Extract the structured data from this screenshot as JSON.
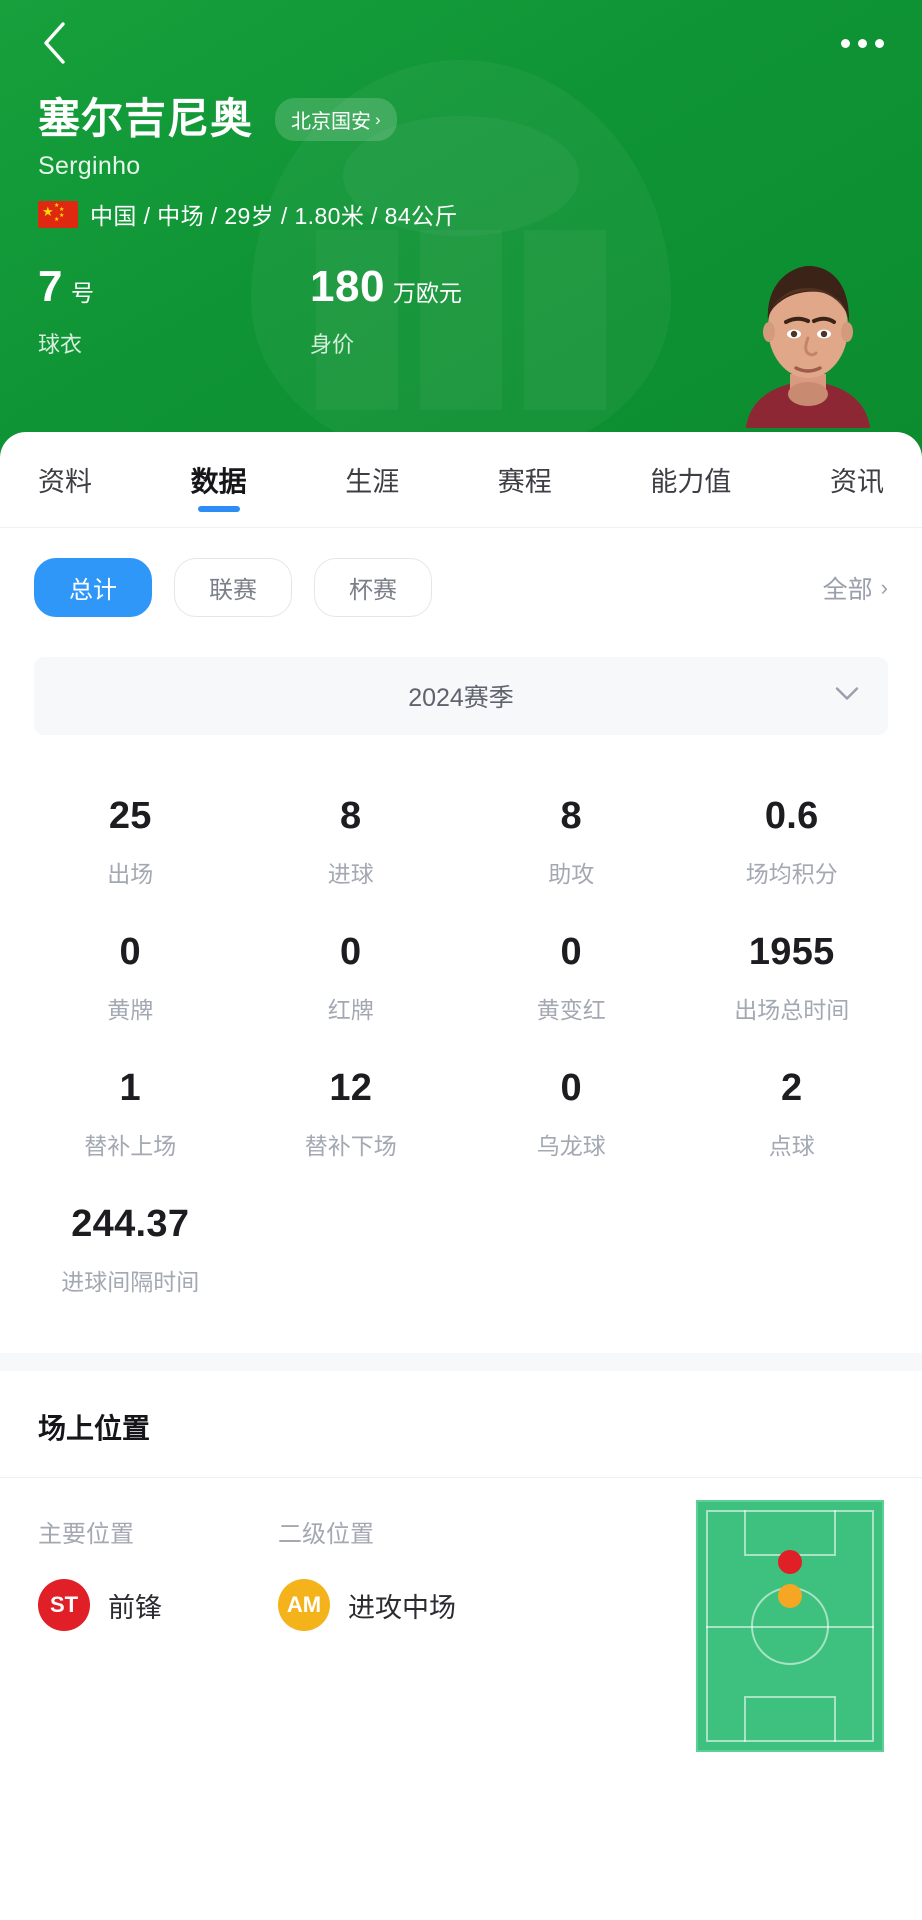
{
  "header": {
    "back_icon": "chevron-left-icon",
    "more_icon": "more-horizontal-icon",
    "player_name": "塞尔吉尼奥",
    "team_chip": "北京国安",
    "team_chip_caret": "›",
    "player_alias": "Serginho",
    "flag_icon": "china-flag-icon",
    "meta_line": "中国 / 中场 / 29岁 / 1.80米 / 84公斤",
    "brand_green": "#0f9435",
    "kv": [
      {
        "num": "7",
        "unit": "号",
        "label": "球衣"
      },
      {
        "num": "180",
        "unit": "万欧元",
        "label": "身价"
      }
    ]
  },
  "tabs": [
    {
      "label": "资料",
      "active": false
    },
    {
      "label": "数据",
      "active": true
    },
    {
      "label": "生涯",
      "active": false
    },
    {
      "label": "赛程",
      "active": false
    },
    {
      "label": "能力值",
      "active": false
    },
    {
      "label": "资讯",
      "active": false
    }
  ],
  "tab_accent": "#2e8df5",
  "filters": {
    "chips": [
      {
        "label": "总计",
        "active": true
      },
      {
        "label": "联赛",
        "active": false
      },
      {
        "label": "杯赛",
        "active": false
      }
    ],
    "all_label": "全部",
    "all_caret": "›",
    "chip_active_color": "#2e97f7"
  },
  "season": {
    "label": "2024赛季",
    "caret_icon": "chevron-down-icon"
  },
  "stats": [
    {
      "value": "25",
      "label": "出场"
    },
    {
      "value": "8",
      "label": "进球"
    },
    {
      "value": "8",
      "label": "助攻"
    },
    {
      "value": "0.6",
      "label": "场均积分"
    },
    {
      "value": "0",
      "label": "黄牌"
    },
    {
      "value": "0",
      "label": "红牌"
    },
    {
      "value": "0",
      "label": "黄变红"
    },
    {
      "value": "1955",
      "label": "出场总时间"
    },
    {
      "value": "1",
      "label": "替补上场"
    },
    {
      "value": "12",
      "label": "替补下场"
    },
    {
      "value": "0",
      "label": "乌龙球"
    },
    {
      "value": "2",
      "label": "点球"
    },
    {
      "value": "244.37",
      "label": "进球间隔时间"
    },
    {
      "value": "",
      "label": ""
    },
    {
      "value": "",
      "label": ""
    },
    {
      "value": "",
      "label": ""
    }
  ],
  "positions": {
    "section_title": "场上位置",
    "primary": {
      "head": "主要位置",
      "badge": "ST",
      "name": "前锋",
      "color": "#e01f26"
    },
    "secondary": {
      "head": "二级位置",
      "badge": "AM",
      "name": "进攻中场",
      "color": "#f5b31b"
    },
    "pitch": {
      "field_color": "#3ec17e",
      "line_color": "#9fe3c0",
      "markers": [
        {
          "name": "primary-position-marker",
          "color": "#e01f26",
          "x": 50,
          "y": 24
        },
        {
          "name": "secondary-position-marker",
          "color": "#f5a623",
          "x": 50,
          "y": 38
        }
      ]
    }
  }
}
